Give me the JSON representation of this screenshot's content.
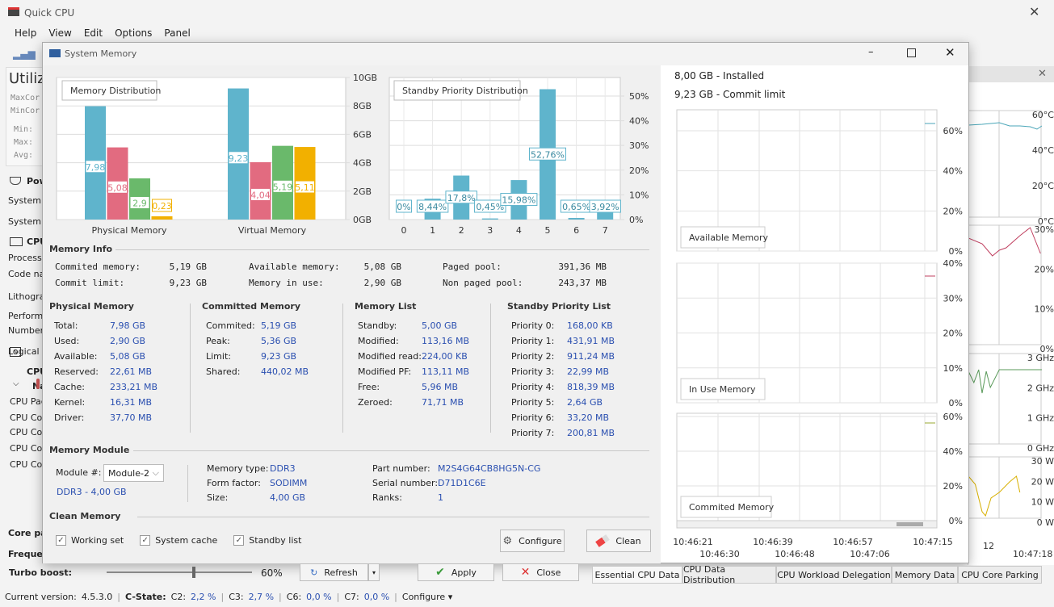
{
  "app": {
    "title": "Quick CPU",
    "menu": [
      "Help",
      "View",
      "Edit",
      "Options",
      "Panel"
    ],
    "left_panel": {
      "util_title": "Utiliz",
      "rows_mono": [
        "MaxCor",
        "MinCor"
      ],
      "stats": [
        "Min:",
        "Max:",
        "Avg:"
      ],
      "items": [
        "Pow",
        "System p",
        "System p",
        "CPU",
        "Processo",
        "Code na",
        "Lithograp",
        "Performa",
        "Number",
        "Logical p",
        "CPU",
        "Na",
        "CPU Pac",
        "CPU Cor",
        "CPU Cor",
        "CPU Cor",
        "CPU Cor",
        "Core pa",
        "Freque"
      ]
    },
    "right_panel": {
      "temp_ticks": [
        "60°C",
        "40°C",
        "20°C",
        "0°C"
      ],
      "pct_ticks": [
        "30%",
        "20%",
        "10%",
        "0%"
      ],
      "ghz_ticks": [
        "3 GHz",
        "2 GHz",
        "1 GHz",
        "0 GHz"
      ],
      "w_ticks": [
        "30 W",
        "20 W",
        "10 W",
        "0 W"
      ],
      "time_labels": [
        "12",
        "10:47:18"
      ]
    },
    "turbo": {
      "label": "Turbo boost:",
      "value": "60%",
      "level": 0.6
    },
    "buttons": {
      "refresh": "Refresh",
      "apply": "Apply",
      "close": "Close"
    },
    "tabs": [
      "Essential CPU Data",
      "CPU Data Distribution",
      "CPU Workload Delegation",
      "Memory Data",
      "CPU Core Parking"
    ],
    "status": {
      "version_label": "Current version:",
      "version": "4.5.3.0",
      "cstate": "C-State:",
      "c2": "C2:",
      "c2v": "2,2 %",
      "c3": "C3:",
      "c3v": "2,7 %",
      "c6": "C6:",
      "c6v": "0,0 %",
      "c7": "C7:",
      "c7v": "0,0 %",
      "configure": "Configure ▾"
    }
  },
  "dialog": {
    "title": "System Memory",
    "installed": "8,00 GB - Installed",
    "commit_limit": "9,23 GB - Commit limit",
    "memory_info": {
      "title": "Memory Info",
      "rows": [
        [
          "Commited memory:",
          "5,19 GB",
          "Available memory:",
          "5,08 GB",
          "Paged pool:",
          "391,36 MB"
        ],
        [
          "Commit limit:",
          "9,23 GB",
          "Memory in use:",
          "2,90 GB",
          "Non paged pool:",
          "243,37 MB"
        ]
      ]
    },
    "physical": {
      "title": "Physical Memory",
      "items": [
        [
          "Total:",
          "7,98 GB"
        ],
        [
          "Used:",
          "2,90 GB"
        ],
        [
          "Available:",
          "5,08 GB"
        ],
        [
          "Reserved:",
          "22,61 MB"
        ],
        [
          "Cache:",
          "233,21 MB"
        ],
        [
          "Kernel:",
          "16,31 MB"
        ],
        [
          "Driver:",
          "37,70 MB"
        ]
      ]
    },
    "committed": {
      "title": "Committed Memory",
      "items": [
        [
          "Commited:",
          "5,19 GB"
        ],
        [
          "Peak:",
          "5,36 GB"
        ],
        [
          "Limit:",
          "9,23 GB"
        ],
        [
          "Shared:",
          "440,02 MB"
        ]
      ]
    },
    "memlist": {
      "title": "Memory List",
      "items": [
        [
          "Standby:",
          "5,00 GB"
        ],
        [
          "Modified:",
          "113,16 MB"
        ],
        [
          "Modified read:",
          "224,00 KB"
        ],
        [
          "Modified PF:",
          "113,11 MB"
        ],
        [
          "Free:",
          "5,96 MB"
        ],
        [
          "Zeroed:",
          "71,71 MB"
        ]
      ]
    },
    "standby": {
      "title": "Standby Priority List",
      "items": [
        [
          "Priority 0:",
          "168,00 KB"
        ],
        [
          "Priority 1:",
          "431,91 MB"
        ],
        [
          "Priority 2:",
          "911,24 MB"
        ],
        [
          "Priority 3:",
          "22,99 MB"
        ],
        [
          "Priority 4:",
          "818,39 MB"
        ],
        [
          "Priority 5:",
          "2,64 GB"
        ],
        [
          "Priority 6:",
          "33,20 MB"
        ],
        [
          "Priority 7:",
          "200,81 MB"
        ]
      ]
    },
    "module": {
      "title": "Memory Module",
      "module_label": "Module #:",
      "module_value": "Module-2",
      "summary": "DDR3 - 4,00 GB",
      "col1": [
        [
          "Memory type:",
          "DDR3"
        ],
        [
          "Form factor:",
          "SODIMM"
        ],
        [
          "Size:",
          "4,00 GB"
        ]
      ],
      "col2": [
        [
          "Part number:",
          "M2S4G64CB8HG5N-CG"
        ],
        [
          "Serial number:",
          "D71D1C6E"
        ],
        [
          "Ranks:",
          "1"
        ]
      ]
    },
    "clean": {
      "title": "Clean Memory",
      "checks": [
        {
          "label": "Working set",
          "checked": true
        },
        {
          "label": "System cache",
          "checked": true
        },
        {
          "label": "Standby list",
          "checked": true
        }
      ],
      "configure": "Configure",
      "clean": "Clean"
    },
    "timecharts": {
      "legends": [
        "Available Memory",
        "In Use Memory",
        "Commited Memory"
      ],
      "ticks": [
        [
          "60%",
          "40%",
          "20%",
          "0%"
        ],
        [
          "40%",
          "30%",
          "20%",
          "10%",
          "0%"
        ],
        [
          "60%",
          "40%",
          "20%",
          "0%"
        ]
      ],
      "times_top": [
        "10:46:21",
        "10:46:39",
        "10:46:57",
        "10:47:15"
      ],
      "times_bottom": [
        "10:46:30",
        "10:46:48",
        "10:47:06"
      ],
      "colors": [
        "#4aa6b8",
        "#c04060",
        "#9aaa30"
      ]
    }
  },
  "colors": {
    "blue": "#5fb4cc",
    "pink": "#e26b80",
    "green": "#6ab96b",
    "gold": "#f2b000"
  },
  "chart_data": [
    {
      "type": "bar",
      "title": "Memory Distribution",
      "categories": [
        "Physical Memory",
        "Virtual Memory"
      ],
      "series": [
        {
          "values": [
            7.98,
            9.23
          ]
        },
        {
          "values": [
            5.08,
            4.04
          ]
        },
        {
          "values": [
            2.9,
            5.19
          ]
        },
        {
          "values": [
            0.23,
            5.11
          ]
        }
      ],
      "labels": [
        [
          "7,98",
          "9,23"
        ],
        [
          "5,08",
          "4,04"
        ],
        [
          "2,9",
          "5,19"
        ],
        [
          "0,23",
          "5,11"
        ]
      ],
      "yticks": [
        "0GB",
        "2GB",
        "4GB",
        "6GB",
        "8GB",
        "10GB"
      ],
      "ylim": [
        0,
        10
      ],
      "grid": true
    },
    {
      "type": "bar",
      "title": "Standby Priority Distribution",
      "categories": [
        "0",
        "1",
        "2",
        "3",
        "4",
        "5",
        "6",
        "7"
      ],
      "values": [
        0,
        8.44,
        17.8,
        0.45,
        15.98,
        52.76,
        0.65,
        3.92
      ],
      "labels": [
        "0%",
        "8,44%",
        "17,8%",
        "0,45%",
        "15,98%",
        "52,76%",
        "0,65%",
        "3,92%"
      ],
      "yticks": [
        "0%",
        "10%",
        "20%",
        "30%",
        "40%",
        "50%"
      ],
      "ylim": [
        0,
        57.5
      ],
      "grid": true
    }
  ]
}
